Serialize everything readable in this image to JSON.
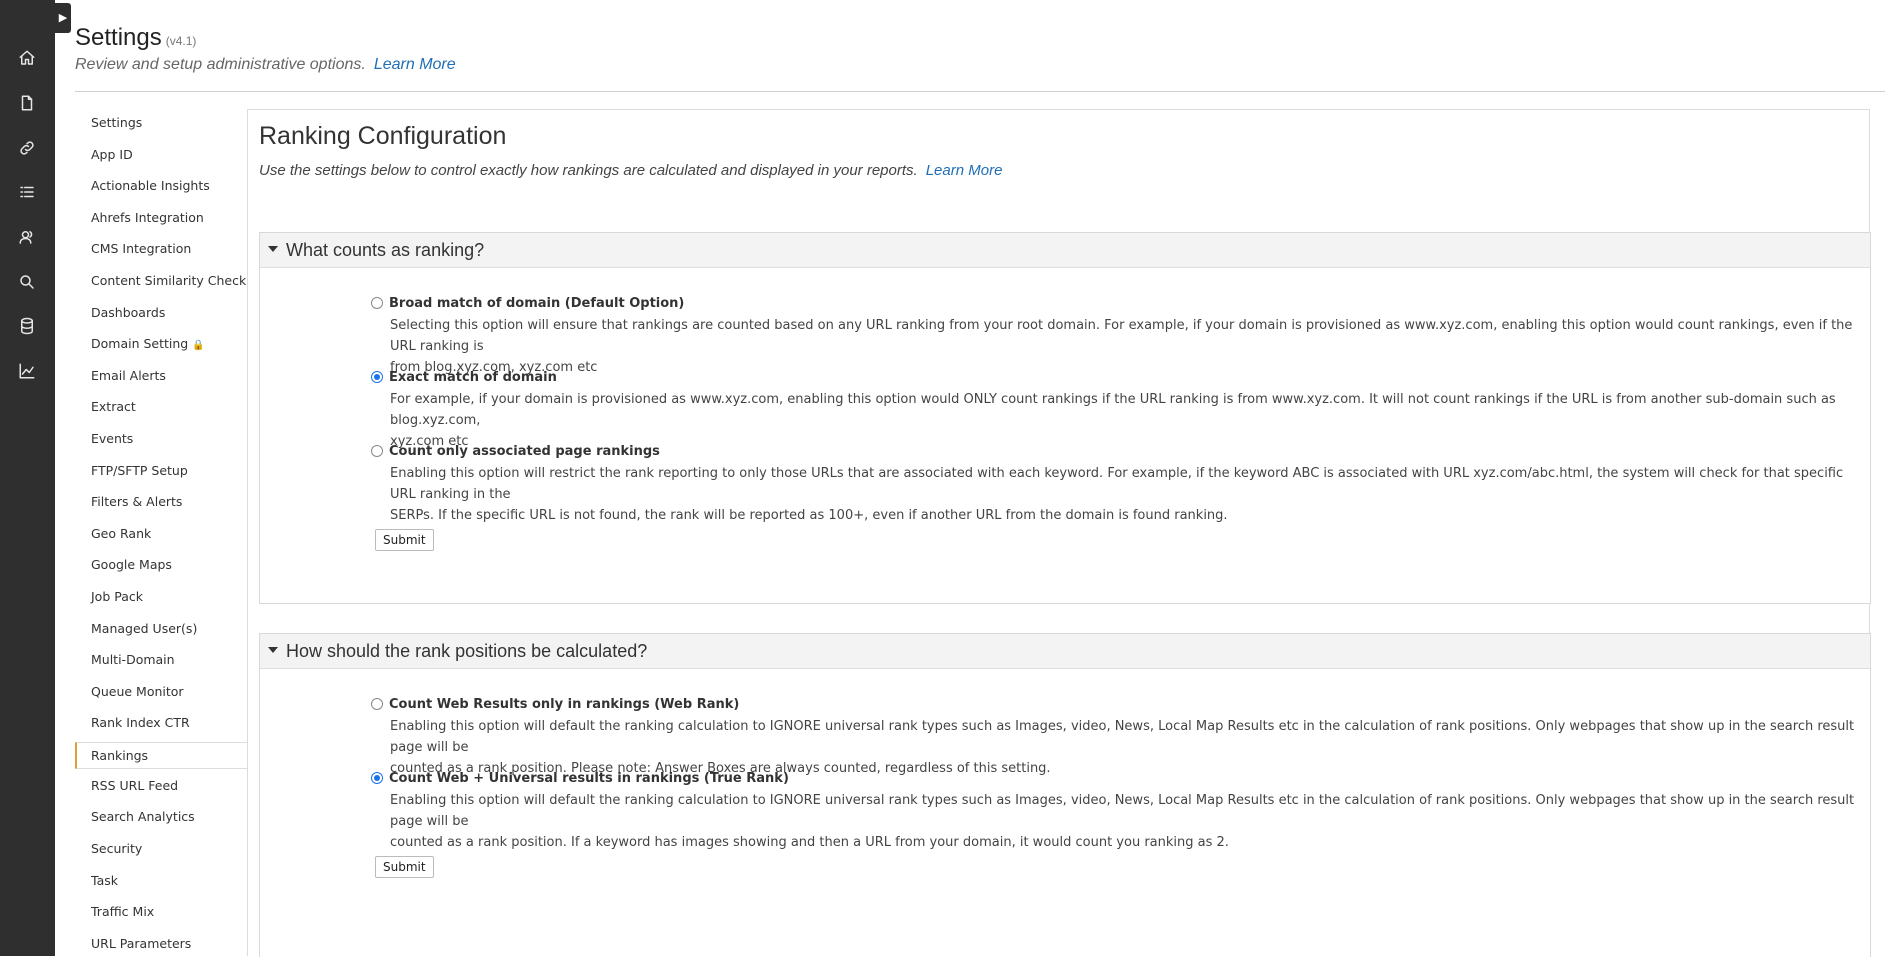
{
  "header": {
    "title": "Settings",
    "version": "(v4.1)",
    "subtitle": "Review and setup administrative options.",
    "learn_more": "Learn More"
  },
  "rail": {
    "toggle_icon": "chevron-right-icon",
    "icons": [
      "home-icon",
      "document-icon",
      "link-icon",
      "list-icon",
      "users-icon",
      "search-icon",
      "database-icon",
      "trend-chart-icon"
    ]
  },
  "settings_nav": {
    "items": [
      "Settings",
      "App ID",
      "Actionable Insights",
      "Ahrefs Integration",
      "CMS Integration",
      "Content Similarity Check",
      "Dashboards",
      "Domain Setting",
      "Email Alerts",
      "Extract",
      "Events",
      "FTP/SFTP Setup",
      "Filters & Alerts",
      "Geo Rank",
      "Google Maps",
      "Job Pack",
      "Managed User(s)",
      "Multi-Domain",
      "Queue Monitor",
      "Rank Index CTR",
      "Rankings",
      "RSS URL Feed",
      "Search Analytics",
      "Security",
      "Task",
      "Traffic Mix",
      "URL Parameters"
    ],
    "active": "Rankings",
    "lock_icon": "lock-icon"
  },
  "main": {
    "title": "Ranking Configuration",
    "description": "Use the settings below to control exactly how rankings are calculated and displayed in your reports.",
    "learn_more": "Learn More",
    "sections": [
      {
        "title": "What counts as ranking?",
        "options": [
          {
            "label": "Broad match of domain (Default Option)",
            "checked": false,
            "desc1": "Selecting this option will ensure that rankings are counted based on any URL ranking from your root domain. For example, if your domain is provisioned as www.xyz.com, enabling this option would count rankings, even if the URL ranking is",
            "desc2": "from blog.xyz.com, xyz.com etc"
          },
          {
            "label": "Exact match of domain",
            "checked": true,
            "desc1": "For example, if your domain is provisioned as www.xyz.com, enabling this option would ONLY count rankings if the URL ranking is from www.xyz.com. It will not count rankings if the URL is from another sub-domain such as blog.xyz.com,",
            "desc2": "xyz.com etc"
          },
          {
            "label": "Count only associated page rankings",
            "checked": false,
            "desc1": "Enabling this option will restrict the rank reporting to only those URLs that are associated with each keyword. For example, if the keyword ABC is associated with URL xyz.com/abc.html, the system will check for that specific URL ranking in the",
            "desc2": "SERPs. If the specific URL is not found, the rank will be reported as 100+, even if another URL from the domain is found ranking."
          }
        ],
        "submit": "Submit"
      },
      {
        "title": "How should the rank positions be calculated?",
        "options": [
          {
            "label": "Count Web Results only in rankings (Web Rank)",
            "checked": false,
            "desc1": "Enabling this option will default the ranking calculation to IGNORE universal rank types such as Images, video, News, Local Map Results etc in the calculation of rank positions. Only webpages that show up in the search result page will be",
            "desc2": "counted as a rank position. Please note: Answer Boxes are always counted, regardless of this setting."
          },
          {
            "label": "Count Web + Universal results in rankings (True Rank)",
            "checked": true,
            "desc1": "Enabling this option will default the ranking calculation to IGNORE universal rank types such as Images, video, News, Local Map Results etc in the calculation of rank positions. Only webpages that show up in the search result page will be",
            "desc2": "counted as a rank position. If a keyword has images showing and then a URL from your domain, it would count you ranking as 2."
          }
        ],
        "submit": "Submit"
      }
    ]
  }
}
